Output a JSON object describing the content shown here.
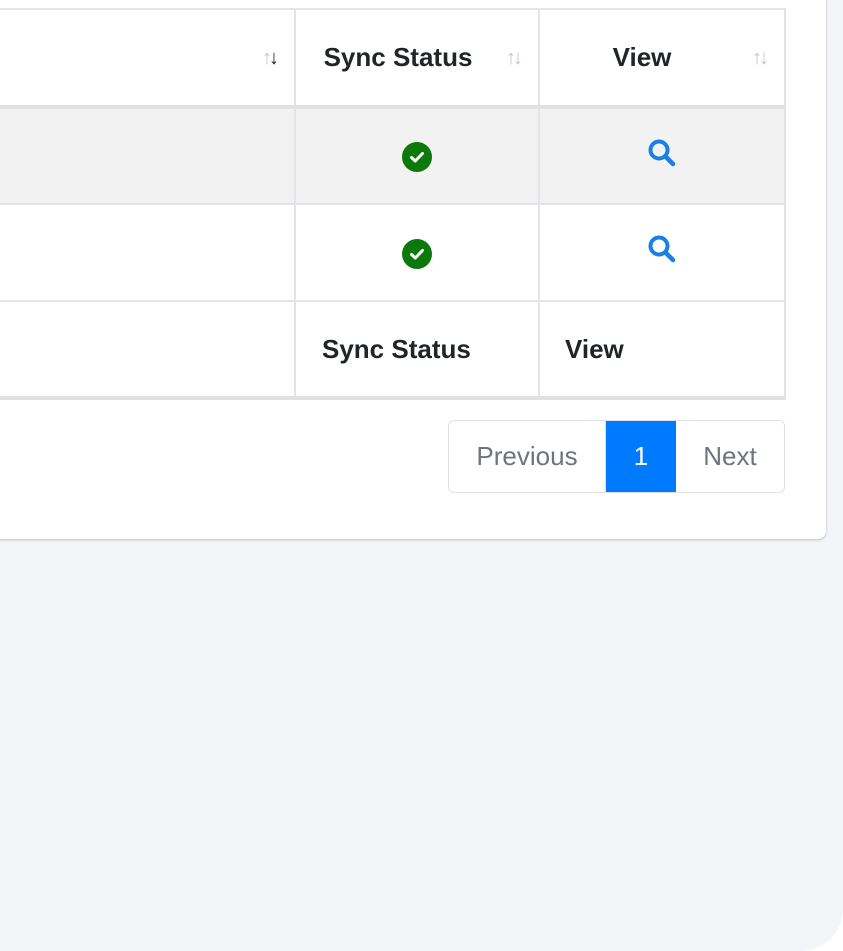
{
  "table": {
    "headers": [
      {
        "label": "",
        "sort": "descending"
      },
      {
        "label": "Sync Status",
        "sort": "none"
      },
      {
        "label": "View",
        "sort": "none"
      }
    ],
    "rows": [
      {
        "sync_status": "synced",
        "view": "search"
      },
      {
        "sync_status": "synced",
        "view": "search"
      }
    ],
    "footer": [
      "",
      "Sync Status",
      "View"
    ]
  },
  "pagination": {
    "previous_label": "Previous",
    "current_page": "1",
    "next_label": "Next"
  },
  "colors": {
    "accent": "#007bff",
    "success": "#0b7a0b",
    "search_icon": "#1a7ee6"
  },
  "icons": {
    "sync_ok": "check-circle-icon",
    "view": "search-icon"
  }
}
